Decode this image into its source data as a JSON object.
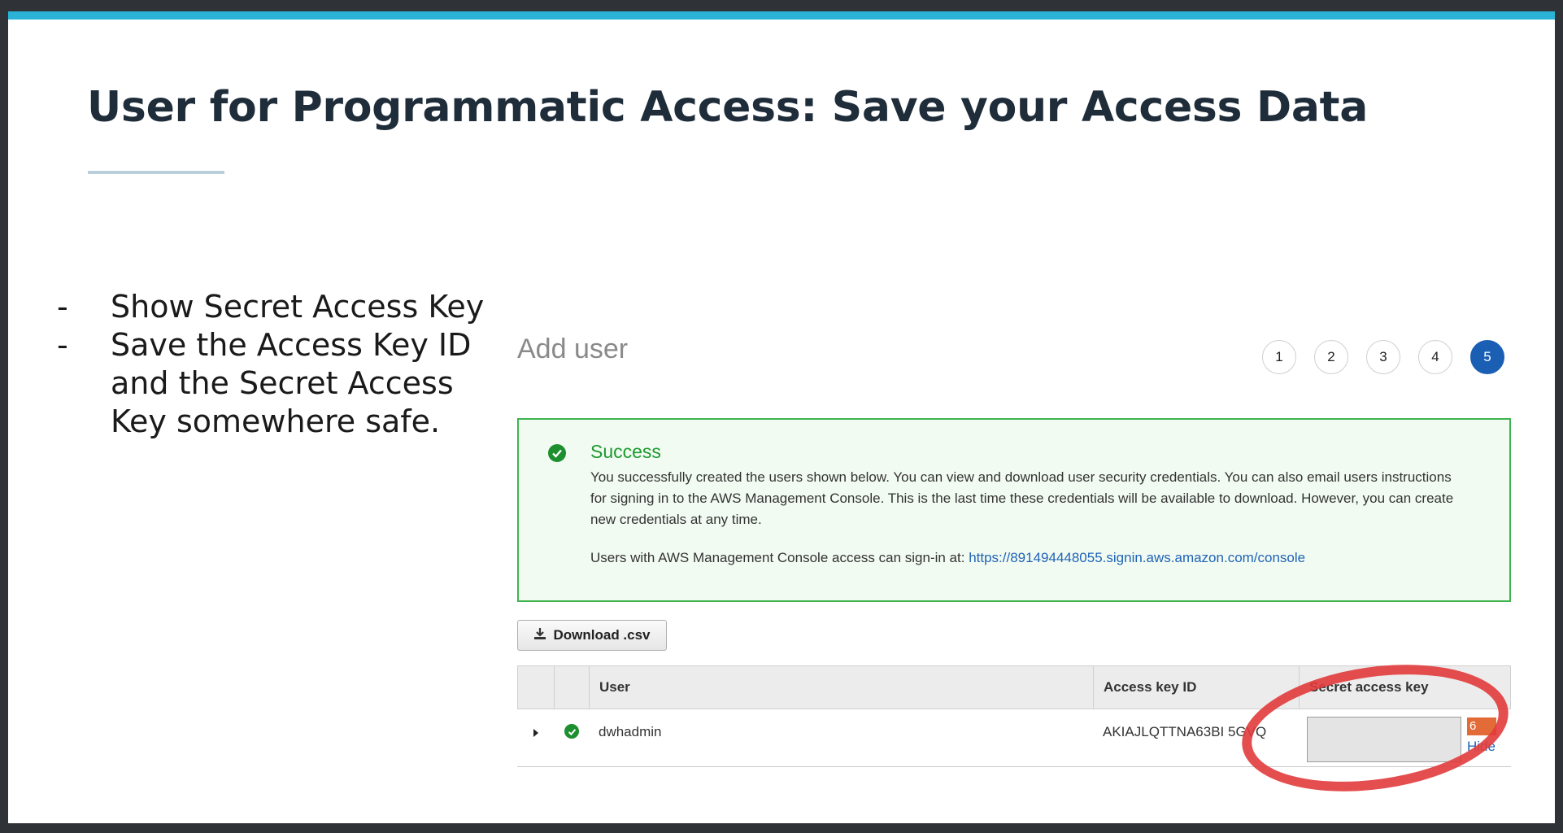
{
  "slide": {
    "title": "User for Programmatic Access:  Save your Access Data",
    "bullets": [
      "Show Secret Access Key",
      "Save the Access Key ID and the Secret Access Key somewhere safe."
    ]
  },
  "aws": {
    "page_title": "Add user",
    "steps": [
      "1",
      "2",
      "3",
      "4",
      "5"
    ],
    "active_step": "5",
    "success": {
      "title": "Success",
      "body": "You successfully created the users shown below. You can view and download user security credentials. You can also email users instructions for signing in to the AWS Management Console. This is the last time these credentials will be available to download. However, you can create new credentials at any time.",
      "signin_prefix": "Users with AWS Management Console access can sign-in at: ",
      "signin_link": "https://891494448055.signin.aws.amazon.com/console"
    },
    "download_label": "Download .csv",
    "table": {
      "headers": [
        "",
        "",
        "User",
        "Access key ID",
        "Secret access key"
      ],
      "rows": [
        {
          "user": "dwhadmin",
          "access_key_id": "AKIAJLQTTNA63BI  5GVQ",
          "secret_suffix": "6",
          "hide_label": "Hide"
        }
      ]
    }
  },
  "colors": {
    "accent_bar": "#2ab3d6",
    "success_green": "#1d9a2f",
    "active_step": "#1a5fb4",
    "annotation_red": "#e23b3b"
  }
}
